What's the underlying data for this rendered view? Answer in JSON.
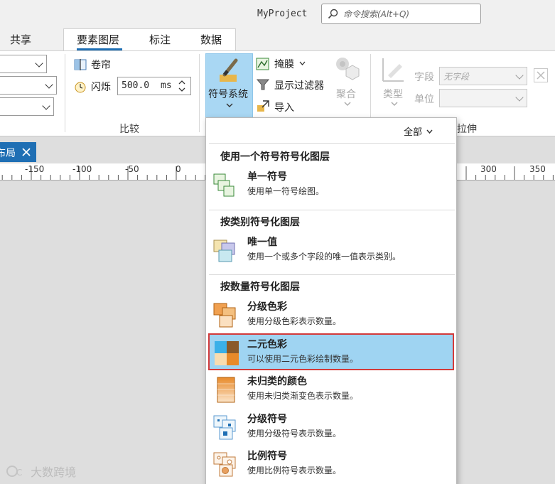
{
  "app": {
    "project_name": "MyProject",
    "search_placeholder": "命令搜索(Alt+Q)"
  },
  "tabs": {
    "share": "共享",
    "feature_layer": "要素图层",
    "labeling": "标注",
    "data": "数据"
  },
  "ribbon": {
    "compare": {
      "swipe_label": "卷帘",
      "flicker_label": "闪烁",
      "flicker_value": "500.0",
      "flicker_unit": "ms",
      "group_label": "比较"
    },
    "drawing": {
      "symbology_label": "符号系统",
      "mask_label": "掩膜",
      "display_filter_label": "显示过滤器",
      "import_label": "导入",
      "aggregate_label": "聚合"
    },
    "extrusion": {
      "type_label": "类型",
      "field_label": "字段",
      "field_value": "无字段",
      "unit_label": "单位",
      "group_label_partial": "拉伸"
    }
  },
  "layout_tab": {
    "label": "布局",
    "close_icon": "close-icon"
  },
  "ruler": {
    "ticks": [
      "-150",
      "-100",
      "-50",
      "0",
      "300",
      "350"
    ]
  },
  "symbology_menu": {
    "filter_label": "全部",
    "sections": [
      {
        "title": "使用一个符号符号化图层",
        "items": [
          {
            "title": "单一符号",
            "desc": "使用单一符号绘图。",
            "icon": "single-symbol-icon"
          }
        ]
      },
      {
        "title": "按类别符号化图层",
        "items": [
          {
            "title": "唯一值",
            "desc": "使用一个或多个字段的唯一值表示类别。",
            "icon": "unique-values-icon"
          }
        ]
      },
      {
        "title": "按数量符号化图层",
        "items": [
          {
            "title": "分级色彩",
            "desc": "使用分级色彩表示数量。",
            "icon": "graduated-colors-icon"
          },
          {
            "title": "二元色彩",
            "desc": "可以使用二元色彩绘制数量。",
            "icon": "bivariate-colors-icon",
            "selected": true
          },
          {
            "title": "未归类的颜色",
            "desc": "使用未归类渐变色表示数量。",
            "icon": "unclassed-colors-icon"
          },
          {
            "title": "分级符号",
            "desc": "使用分级符号表示数量。",
            "icon": "graduated-symbols-icon"
          },
          {
            "title": "比例符号",
            "desc": "使用比例符号表示数量。",
            "icon": "proportional-symbols-icon"
          }
        ]
      }
    ]
  },
  "watermark": "大数跨境"
}
